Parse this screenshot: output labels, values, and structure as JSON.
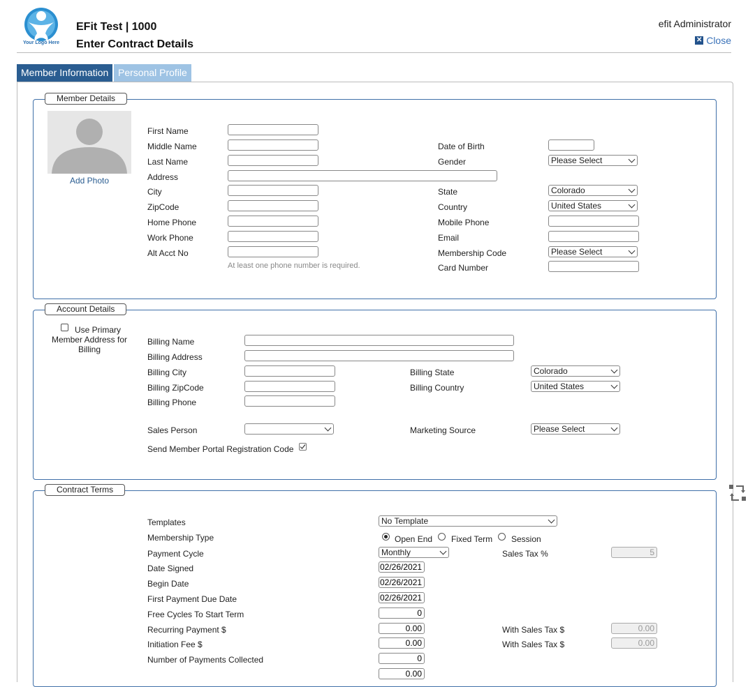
{
  "header": {
    "logo_text": "Your Logo Here",
    "title": "EFit Test | 1000",
    "subtitle": "Enter Contract Details",
    "user": "efit Administrator",
    "close_label": "Close"
  },
  "tabs": [
    {
      "label": "Member Information",
      "active": true
    },
    {
      "label": "Personal Profile",
      "active": false
    }
  ],
  "member_details": {
    "legend": "Member Details",
    "add_photo": "Add Photo",
    "first_name": "First Name",
    "middle_name": "Middle Name",
    "last_name": "Last Name",
    "address": "Address",
    "city": "City",
    "zipcode": "ZipCode",
    "home_phone": "Home Phone",
    "work_phone": "Work Phone",
    "alt_acct_no": "Alt Acct No",
    "phone_note": "At least one phone number is required.",
    "date_of_birth": "Date of Birth",
    "gender": "Gender",
    "gender_value": "Please Select",
    "state": "State",
    "state_value": "Colorado",
    "country": "Country",
    "country_value": "United States",
    "mobile_phone": "Mobile Phone",
    "email": "Email",
    "membership_code": "Membership Code",
    "membership_code_value": "Please Select",
    "card_number": "Card Number"
  },
  "account_details": {
    "legend": "Account Details",
    "use_primary": "Use Primary Member Address for Billing",
    "billing_name": "Billing Name",
    "billing_address": "Billing Address",
    "billing_city": "Billing City",
    "billing_zipcode": "Billing ZipCode",
    "billing_phone": "Billing Phone",
    "billing_state": "Billing State",
    "billing_state_value": "Colorado",
    "billing_country": "Billing Country",
    "billing_country_value": "United States",
    "sales_person": "Sales Person",
    "sales_person_value": "",
    "marketing_source": "Marketing Source",
    "marketing_source_value": "Please Select",
    "send_portal_code": "Send Member Portal Registration Code",
    "send_portal_checked": true
  },
  "contract_terms": {
    "legend": "Contract Terms",
    "templates": "Templates",
    "templates_value": "No Template",
    "membership_type": "Membership Type",
    "types": [
      "Open End",
      "Fixed Term",
      "Session"
    ],
    "selected_type": "Open End",
    "payment_cycle": "Payment Cycle",
    "payment_cycle_value": "Monthly",
    "sales_tax": "Sales Tax %",
    "sales_tax_value": "5",
    "date_signed": "Date Signed",
    "date_signed_value": "02/26/2021",
    "begin_date": "Begin Date",
    "begin_date_value": "02/26/2021",
    "first_payment_due": "First Payment Due Date",
    "first_payment_due_value": "02/26/2021",
    "free_cycles": "Free Cycles To Start Term",
    "free_cycles_value": "0",
    "recurring_payment": "Recurring Payment $",
    "recurring_payment_value": "0.00",
    "with_sales_tax_1": "With Sales Tax $",
    "with_sales_tax_1_value": "0.00",
    "initiation_fee": "Initiation Fee $",
    "initiation_fee_value": "0.00",
    "with_sales_tax_2": "With Sales Tax $",
    "with_sales_tax_2_value": "0.00",
    "payments_collected": "Number of Payments Collected",
    "payments_collected_value": "0",
    "next_value": "0.00"
  },
  "colors": {
    "accent": "#2a5d91",
    "tab_inactive": "#9ec3e4",
    "fieldset_border": "#3f6fa8",
    "link": "#3b73b9"
  }
}
